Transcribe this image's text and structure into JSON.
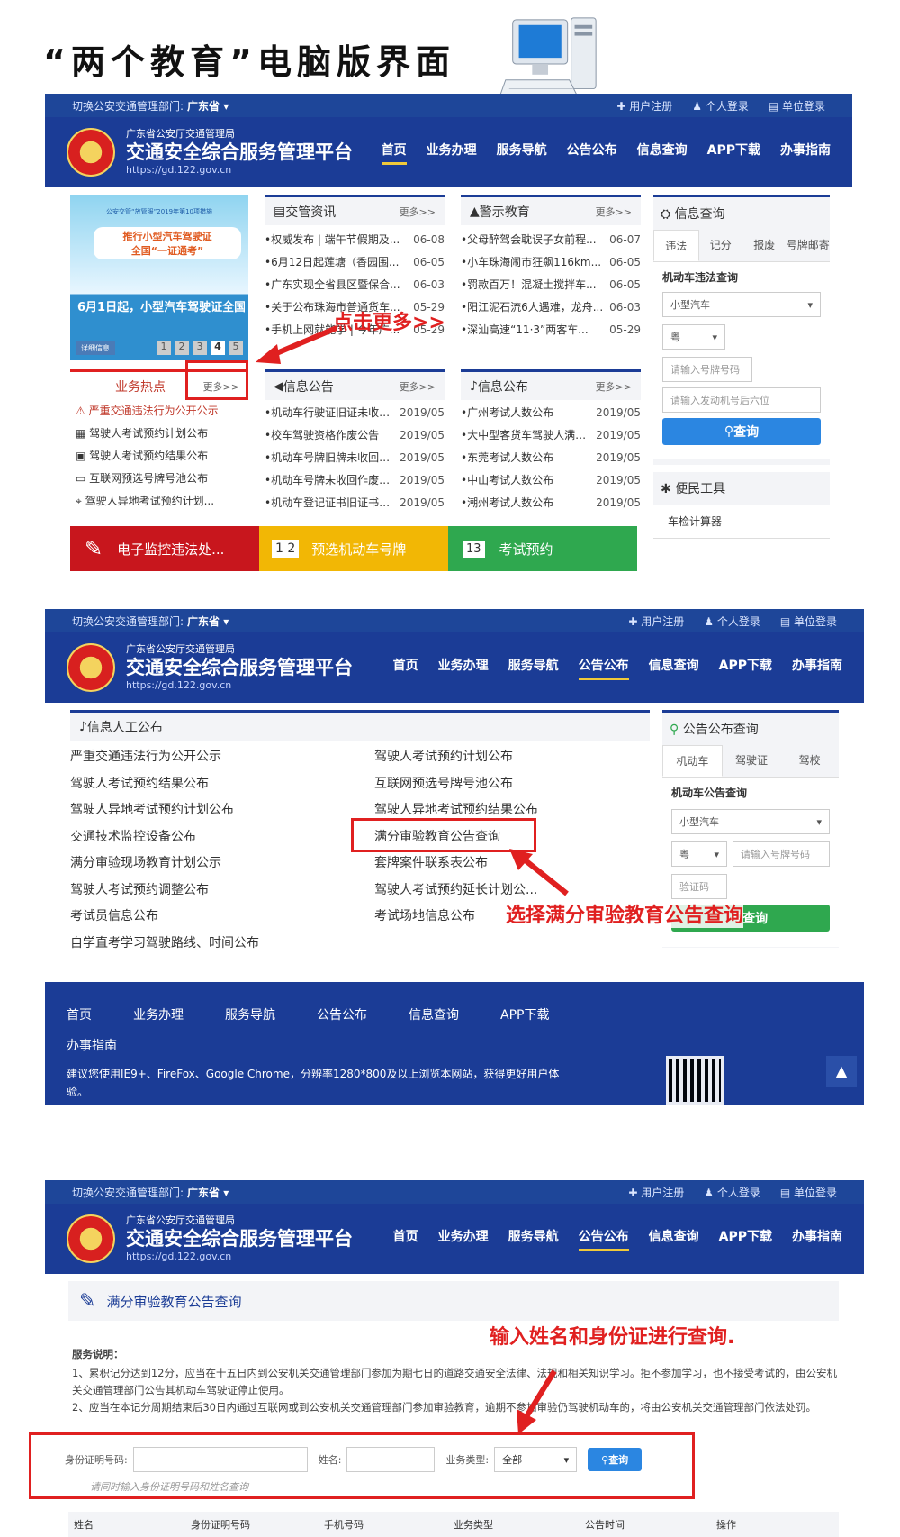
{
  "page_title": "“两个教育”电脑版界面",
  "colors": {
    "brand": "#1b3c96",
    "accent_red": "#e02020",
    "button_blue": "#2b86e1",
    "tile_red": "#c8161d",
    "tile_yellow": "#f2b705",
    "tile_green": "#2fa84f"
  },
  "header": {
    "region_label": "切换公安交通管理部门:",
    "region": "广东省 ▾",
    "links": [
      "✚ 用户注册",
      "♟ 个人登录",
      "▤ 单位登录"
    ],
    "subtitle": "广东省公安厅交通管理局",
    "title": "交通安全综合服务管理平台",
    "url": "https://gd.122.gov.cn",
    "nav": [
      "首页",
      "业务办理",
      "服务导航",
      "公告公布",
      "信息查询",
      "APP下载",
      "办事指南"
    ]
  },
  "panel1": {
    "banner": {
      "line1": "推行小型汽车驾驶证",
      "line2": "全国“一证通考”",
      "caption": "6月1日起，小型汽车驾驶证全国...",
      "tag": "公安交管“放管服”2019年第10项措施",
      "btn": "详细信息",
      "pages": [
        "1",
        "2",
        "3",
        "4",
        "5"
      ]
    },
    "news": {
      "title": "交管资讯",
      "more": "更多>>",
      "items": [
        {
          "t": "•权威发布 | 端午节假期及...",
          "d": "06-08"
        },
        {
          "t": "•6月12日起莲塘（香园围...",
          "d": "06-05"
        },
        {
          "t": "•广东实现全省县区暨保合...",
          "d": "06-03"
        },
        {
          "t": "•关于公布珠海市普通货车...",
          "d": "05-29"
        },
        {
          "t": "•手机上网就能学 | 今年广...",
          "d": "05-29"
        }
      ]
    },
    "warning": {
      "title": "警示教育",
      "more": "更多>>",
      "items": [
        {
          "t": "•父母醉驾会耽误子女前程...",
          "d": "06-07"
        },
        {
          "t": "•小车珠海闹市狂飙116km...",
          "d": "06-05"
        },
        {
          "t": "•罚款百万！混凝土搅拌车...",
          "d": "06-05"
        },
        {
          "t": "•阳江泥石流6人遇难，龙舟...",
          "d": "06-03"
        },
        {
          "t": "•深汕高速“11·3”两客车...",
          "d": "05-29"
        }
      ]
    },
    "hot": {
      "title": "业务热点",
      "more": "更多>>",
      "items": [
        "严重交通违法行为公开公示",
        "驾驶人考试预约计划公布",
        "驾驶人考试预约结果公布",
        "互联网预选号牌号池公布",
        "驾驶人异地考试预约计划..."
      ]
    },
    "info": {
      "title": "信息公告",
      "more": "更多>>",
      "items": [
        {
          "t": "•机动车行驶证旧证未收回...",
          "d": "2019/05"
        },
        {
          "t": "•校车驾驶资格作废公告",
          "d": "2019/05"
        },
        {
          "t": "•机动车号牌旧牌未收回作...",
          "d": "2019/05"
        },
        {
          "t": "•机动车号牌未收回作废公...",
          "d": "2019/05"
        },
        {
          "t": "•机动车登记证书旧证书未...",
          "d": "2019/05"
        }
      ]
    },
    "info2": {
      "title": "信息公布",
      "more": "更多>>",
      "items": [
        {
          "t": "•广州考试人数公布",
          "d": "2019/05"
        },
        {
          "t": "•大中型客货车驾驶人满分...",
          "d": "2019/05"
        },
        {
          "t": "•东莞考试人数公布",
          "d": "2019/05"
        },
        {
          "t": "•中山考试人数公布",
          "d": "2019/05"
        },
        {
          "t": "•潮州考试人数公布",
          "d": "2019/05"
        }
      ]
    },
    "query": {
      "title": "信息查询",
      "tabs": [
        "违法",
        "记分",
        "报废",
        "号牌邮寄"
      ],
      "subtitle": "机动车违法查询",
      "select": "小型汽车",
      "province": "粤",
      "plate_ph": "请输入号牌号码",
      "engine_ph": "请输入发动机号后六位",
      "btn": "查询"
    },
    "tools": {
      "title": "便民工具",
      "item": "车检计算器"
    },
    "tiles": [
      "电子监控违法处...",
      "预选机动车号牌",
      "考试预约"
    ],
    "callout": "点击更多>>"
  },
  "panel2": {
    "section_title": "信息人工公布",
    "left": [
      "严重交通违法行为公开公示",
      "驾驶人考试预约结果公布",
      "驾驶人异地考试预约计划公布",
      "交通技术监控设备公布",
      "满分审验现场教育计划公示",
      "驾驶人考试预约调整公布",
      "考试员信息公布",
      "自学直考学习驾驶路线、时间公布"
    ],
    "right": [
      "驾驶人考试预约计划公布",
      "互联网预选号牌号池公布",
      "驾驶人异地考试预约结果公布",
      "满分审验教育公告查询",
      "套牌案件联系表公布",
      "驾驶人考试预约延长计划公...",
      "考试场地信息公布"
    ],
    "query": {
      "title": "公告公布查询",
      "tabs": [
        "机动车",
        "驾驶证",
        "驾校"
      ],
      "subtitle": "机动车公告查询",
      "select": "小型汽车",
      "province": "粤",
      "plate_ph": "请输入号牌号码",
      "captcha_ph": "验证码",
      "btn": "查询"
    },
    "callout": "选择满分审验教育公告查询",
    "footer": {
      "nav": [
        "首页",
        "业务办理",
        "服务导航",
        "公告公布",
        "信息查询",
        "APP下载"
      ],
      "nav2": "办事指南",
      "note": "建议您使用IE9+、FireFox、Google Chrome，分辨率1280*800及以上浏览本网站，获得更好用户体验。",
      "up": "▲"
    }
  },
  "panel3": {
    "page_title": "满分审验教育公告查询",
    "callout": "输入姓名和身份证进行查询.",
    "notes_title": "服务说明：",
    "note1": "1、累积记分达到12分，应当在十五日内到公安机关交通管理部门参加为期七日的道路交通安全法律、法规和相关知识学习。拒不参加学习，也不接受考试的，由公安机关交通管理部门公告其机动车驾驶证停止使用。",
    "note2": "2、应当在本记分周期结束后30日内通过互联网或到公安机关交通管理部门参加审验教育，逾期不参加审验仍驾驶机动车的，将由公安机关交通管理部门依法处罚。",
    "form": {
      "id_label": "身份证明号码:",
      "name_label": "姓名:",
      "type_label": "业务类型:",
      "type_value": "全部",
      "btn": "查询",
      "hint": "请同时输入身份证明号码和姓名查询"
    },
    "columns": [
      "姓名",
      "身份证明号码",
      "手机号码",
      "业务类型",
      "公告时间",
      "操作"
    ]
  }
}
